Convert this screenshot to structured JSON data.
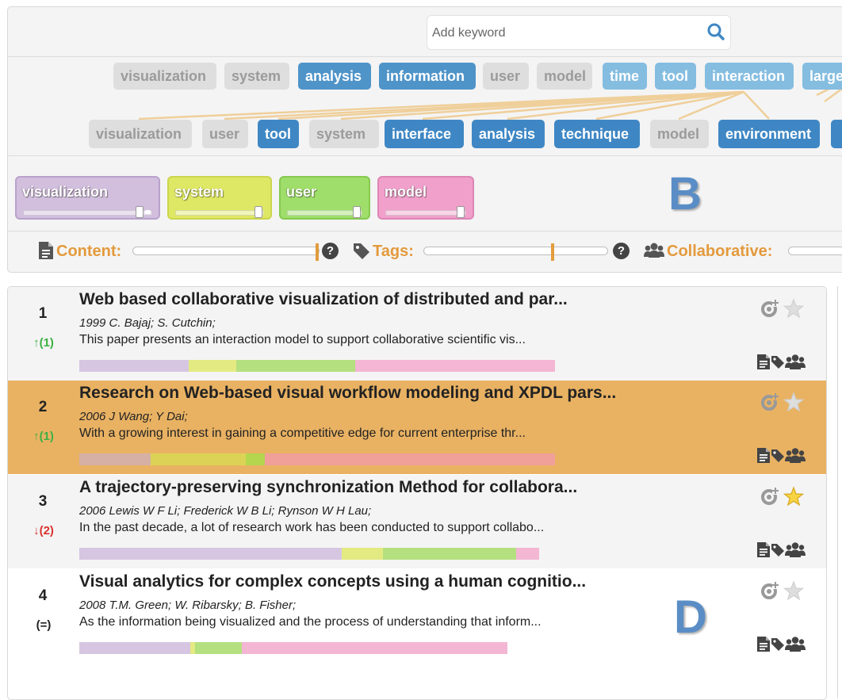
{
  "search": {
    "placeholder": "Add keyword",
    "icon": "search-icon"
  },
  "tag_cloud_top": [
    {
      "label": "visualization",
      "style": "grey"
    },
    {
      "label": "system",
      "style": "grey"
    },
    {
      "label": "analysis",
      "style": "blue"
    },
    {
      "label": "information",
      "style": "blue"
    },
    {
      "label": "user",
      "style": "grey"
    },
    {
      "label": "model",
      "style": "grey"
    },
    {
      "label": "time",
      "style": "lblue"
    },
    {
      "label": "tool",
      "style": "lblue"
    },
    {
      "label": "interaction",
      "style": "lblue"
    },
    {
      "label": "large",
      "style": "lblue"
    }
  ],
  "tag_cloud_bottom": [
    {
      "label": "visualization",
      "style": "grey"
    },
    {
      "label": "user",
      "style": "grey"
    },
    {
      "label": "tool",
      "style": "blue"
    },
    {
      "label": "system",
      "style": "grey"
    },
    {
      "label": "interface",
      "style": "blue"
    },
    {
      "label": "analysis",
      "style": "blue"
    },
    {
      "label": "technique",
      "style": "blue"
    },
    {
      "label": "model",
      "style": "grey"
    },
    {
      "label": "environment",
      "style": "blue"
    },
    {
      "label": "",
      "style": "blue"
    }
  ],
  "weights": [
    {
      "label": "visualization",
      "color": "#d2bedd",
      "border": "#b9a2cc",
      "weight": 0.94
    },
    {
      "label": "system",
      "color": "#dfe864",
      "border": "#cbd54c",
      "weight": 1.0
    },
    {
      "label": "user",
      "color": "#9fde6a",
      "border": "#86c950",
      "weight": 1.0
    },
    {
      "label": "model",
      "color": "#f0a0cb",
      "border": "#dd86b5",
      "weight": 1.0
    }
  ],
  "section_label_b": "B",
  "section_label_d": "D",
  "controls": {
    "content_label": "Content:",
    "tags_label": "Tags:",
    "collab_label": "Collaborative:",
    "help": "?"
  },
  "papers": [
    {
      "rank": "1",
      "move": "↑(1)",
      "move_type": "up",
      "highlighted": false,
      "starred": false,
      "title": "Web based collaborative visualization of distributed and par...",
      "meta": "1999 C. Bajaj; S. Cutchin;",
      "abstract": "This paper presents an interaction model to support collaborative scientific vis...",
      "segments": [
        {
          "color": "#d6c6e2",
          "value": 23
        },
        {
          "color": "#e3ea82",
          "value": 10
        },
        {
          "color": "#b4e07f",
          "value": 25
        },
        {
          "color": "#f3b6d3",
          "value": 42
        }
      ],
      "bar_total": 0.6
    },
    {
      "rank": "2",
      "move": "↑(1)",
      "move_type": "up",
      "highlighted": true,
      "starred": false,
      "title": "Research on Web-based visual workflow modeling and XPDL pars...",
      "meta": "2006 J Wang; Y Dai;",
      "abstract": "With a growing interest in gaining a competitive edge for current enterprise thr...",
      "segments": [
        {
          "color": "#d6b0a4",
          "value": 15
        },
        {
          "color": "#dcd356",
          "value": 20
        },
        {
          "color": "#b4d64e",
          "value": 4
        },
        {
          "color": "#f09f99",
          "value": 61
        }
      ],
      "bar_total": 0.6
    },
    {
      "rank": "3",
      "move": "↓(2)",
      "move_type": "down",
      "highlighted": false,
      "starred": true,
      "title": "A trajectory-preserving synchronization Method for collabora...",
      "meta": "2006 Lewis W F Li; Frederick W B Li; Rynson W H Lau;",
      "abstract": "In the past decade, a lot of research work has been conducted to support collabo...",
      "segments": [
        {
          "color": "#d6c6e2",
          "value": 57
        },
        {
          "color": "#e3ea82",
          "value": 9
        },
        {
          "color": "#b4e07f",
          "value": 29
        },
        {
          "color": "#f3b6d3",
          "value": 5
        }
      ],
      "bar_total": 0.58
    },
    {
      "rank": "4",
      "move": "(=)",
      "move_type": "eq",
      "highlighted": false,
      "starred": false,
      "title": "Visual analytics for complex concepts using a human cognitio...",
      "meta": "2008 T.M. Green; W. Ribarsky; B. Fisher;",
      "abstract": "As the information being visualized and the process of understanding that inform...",
      "segments": [
        {
          "color": "#d6c6e2",
          "value": 26
        },
        {
          "color": "#e3ea82",
          "value": 1
        },
        {
          "color": "#b4e07f",
          "value": 11
        },
        {
          "color": "#f3b6d3",
          "value": 62
        }
      ],
      "bar_total": 0.54
    }
  ]
}
